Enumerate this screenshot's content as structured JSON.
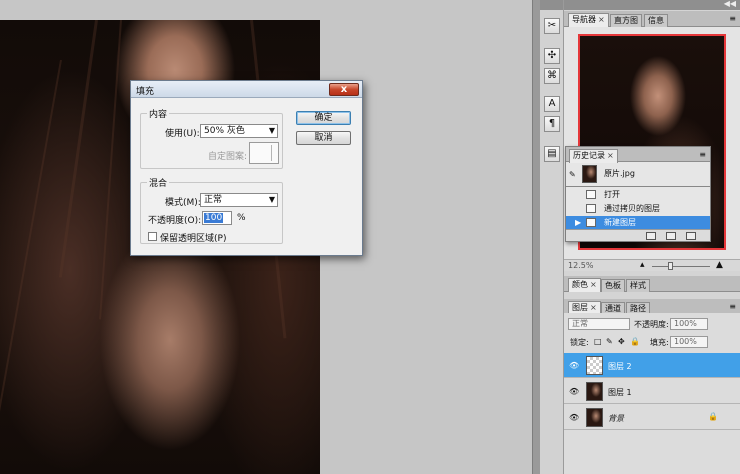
{
  "fill_dialog": {
    "title": "填充",
    "close_glyph": "x",
    "content_group": {
      "legend": "内容",
      "use_label": "使用(U):",
      "use_value": "50% 灰色",
      "custom_pattern_label": "自定图案:"
    },
    "blend_group": {
      "legend": "混合",
      "mode_label": "模式(M):",
      "mode_value": "正常",
      "opacity_label": "不透明度(O):",
      "opacity_value": "100",
      "opacity_unit": "%",
      "preserve_transparency_label": "保留透明区域(P)",
      "preserve_transparency_checked": false
    },
    "ok_label": "确定",
    "cancel_label": "取消"
  },
  "navigator_panel": {
    "tabs": [
      {
        "label": "导航器",
        "close": "×",
        "active": true
      },
      {
        "label": "直方图",
        "active": false
      },
      {
        "label": "信息",
        "active": false
      }
    ],
    "zoom_value": "12.5%"
  },
  "history_panel": {
    "tab_label": "历史记录",
    "tab_close": "×",
    "snapshot_name": "原片.jpg",
    "items": [
      {
        "label": "打开",
        "selected": false
      },
      {
        "label": "通过拷贝的图层",
        "selected": false
      },
      {
        "label": "新建图层",
        "selected": true
      }
    ]
  },
  "color_panel": {
    "tabs": [
      {
        "label": "颜色",
        "close": "×",
        "active": true
      },
      {
        "label": "色板",
        "active": false
      },
      {
        "label": "样式",
        "active": false
      }
    ]
  },
  "layers_panel": {
    "tabs": [
      {
        "label": "图层",
        "close": "×",
        "active": true
      },
      {
        "label": "通道",
        "active": false
      },
      {
        "label": "路径",
        "active": false
      }
    ],
    "blend_mode": "正常",
    "opacity_label": "不透明度:",
    "opacity_value": "100%",
    "lock_label": "锁定:",
    "fill_label": "填充:",
    "fill_value": "100%",
    "layers": [
      {
        "name": "图层 2",
        "selected": true,
        "thumb": "transparent"
      },
      {
        "name": "图层 1",
        "selected": false,
        "thumb": "photo"
      },
      {
        "name": "背景",
        "selected": false,
        "thumb": "photo",
        "locked": true
      }
    ]
  },
  "colors": {
    "selection_blue": "#41a0e8",
    "nav_frame_red": "#e5373a"
  }
}
